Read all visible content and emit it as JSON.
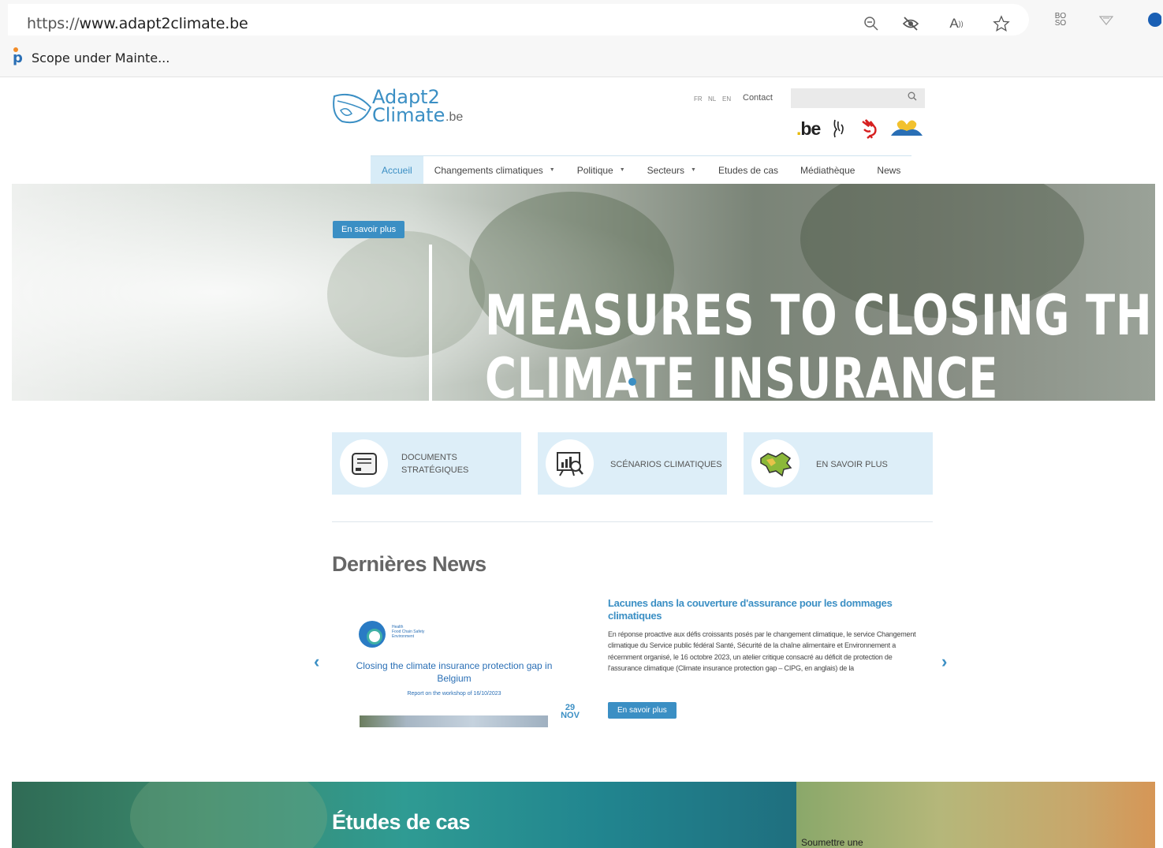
{
  "browser": {
    "url_prefix": "https://",
    "url_domain": "www.adapt2climate.be",
    "bookmark": "Scope under Mainte...",
    "bookmark_icon": "p",
    "bo_label": "BO\nSO"
  },
  "header": {
    "logo_line1": "Adapt2",
    "logo_line2": "Climate",
    "logo_suffix": ".be",
    "languages": [
      "FR",
      "NL",
      "EN"
    ],
    "contact": "Contact",
    "search_placeholder": "",
    "gov_be": "be"
  },
  "nav": {
    "items": [
      {
        "label": "Accueil",
        "caret": false
      },
      {
        "label": "Changements climatiques",
        "caret": true
      },
      {
        "label": "Politique",
        "caret": true
      },
      {
        "label": "Secteurs",
        "caret": true
      },
      {
        "label": "Etudes de cas",
        "caret": false
      },
      {
        "label": "Médiathèque",
        "caret": false
      },
      {
        "label": "News",
        "caret": false
      }
    ]
  },
  "hero": {
    "button": "En savoir plus",
    "title_line1": "MEASURES TO CLOSING THE",
    "title_line2": "CLIMATE INSURANCE"
  },
  "cards": [
    {
      "line1": "DOCUMENTS",
      "line2": "STRATÉGIQUES",
      "icon": "document-icon"
    },
    {
      "line1": "SCÉNARIOS CLIMATIQUES",
      "line2": "",
      "icon": "chart-presentation-icon"
    },
    {
      "line1": "EN SAVOIR PLUS",
      "line2": "",
      "icon": "belgium-map-icon"
    }
  ],
  "news": {
    "heading": "Dernières News",
    "thumb_org": "Health\nFood Chain Safety\nEnvironment",
    "thumb_title": "Closing the climate insurance protection gap in Belgium",
    "thumb_sub": "Report on the workshop of 16/10/2023",
    "date_day": "29",
    "date_month": "NOV",
    "title": "Lacunes dans la couverture d'assurance pour les dommages climatiques",
    "body": "En réponse proactive aux défis croissants posés par le changement climatique, le service Changement climatique du Service public fédéral Santé, Sécurité de la chaîne alimentaire et Environnement a récemment organisé, le 16 octobre 2023, un atelier critique consacré au déficit de protection de l'assurance climatique (Climate insurance protection gap – CIPG, en anglais) de la",
    "button": "En savoir plus"
  },
  "footer": {
    "cases_title": "Études de cas",
    "submit": "Soumettre une"
  },
  "colors": {
    "accent": "#3b8fc4",
    "card_bg": "#ddeef8",
    "nav_active_bg": "#d8ecf7"
  }
}
